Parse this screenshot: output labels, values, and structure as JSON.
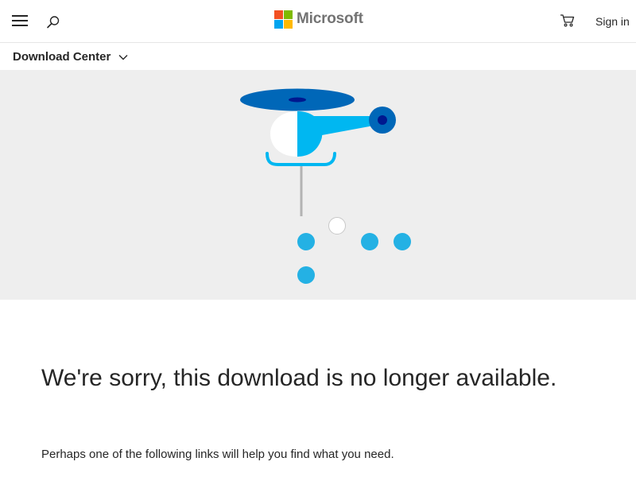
{
  "header": {
    "brand": "Microsoft",
    "signin_label": "Sign in",
    "logo_colors": [
      "#f25022",
      "#7fba00",
      "#00a4ef",
      "#ffb900"
    ]
  },
  "subnav": {
    "title": "Download Center"
  },
  "content": {
    "heading": "We're sorry, this download is no longer available.",
    "message": "Perhaps one of the following links will help you find what you need."
  },
  "theme": {
    "hero_background": "#eeeeee",
    "rotor_blue": "#0067b8",
    "cabin_cyan": "#00b7f1",
    "dot_cyan": "#24b1e4"
  },
  "icons": {
    "menu": "hamburger-menu-icon",
    "search": "search-icon",
    "cart": "shopping-cart-icon",
    "subnav_chevron": "chevron-down-icon"
  }
}
